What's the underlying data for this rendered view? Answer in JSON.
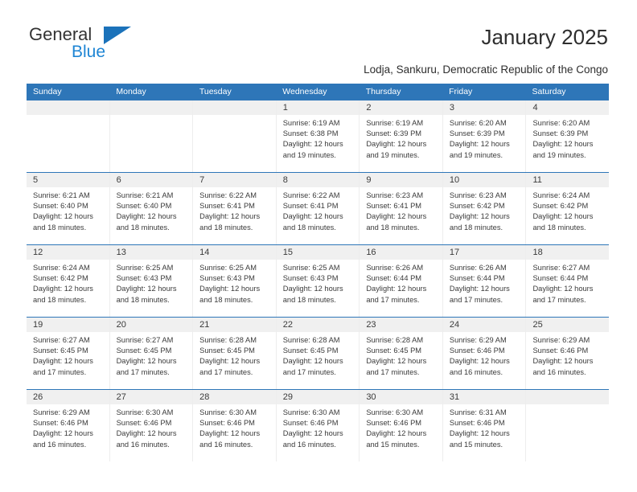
{
  "brand": {
    "name_primary": "General",
    "name_secondary": "Blue",
    "triangle_color": "#1B72BA",
    "secondary_color": "#1E85D4"
  },
  "header": {
    "title": "January 2025",
    "subtitle": "Lodja, Sankuru, Democratic Republic of the Congo",
    "accent_color": "#2E76B8"
  },
  "calendar": {
    "weekday_headers": [
      "Sunday",
      "Monday",
      "Tuesday",
      "Wednesday",
      "Thursday",
      "Friday",
      "Saturday"
    ],
    "weeks": [
      [
        {
          "day": "",
          "sunrise": "",
          "sunset": "",
          "daylight1": "",
          "daylight2": ""
        },
        {
          "day": "",
          "sunrise": "",
          "sunset": "",
          "daylight1": "",
          "daylight2": ""
        },
        {
          "day": "",
          "sunrise": "",
          "sunset": "",
          "daylight1": "",
          "daylight2": ""
        },
        {
          "day": "1",
          "sunrise": "Sunrise: 6:19 AM",
          "sunset": "Sunset: 6:38 PM",
          "daylight1": "Daylight: 12 hours",
          "daylight2": "and 19 minutes."
        },
        {
          "day": "2",
          "sunrise": "Sunrise: 6:19 AM",
          "sunset": "Sunset: 6:39 PM",
          "daylight1": "Daylight: 12 hours",
          "daylight2": "and 19 minutes."
        },
        {
          "day": "3",
          "sunrise": "Sunrise: 6:20 AM",
          "sunset": "Sunset: 6:39 PM",
          "daylight1": "Daylight: 12 hours",
          "daylight2": "and 19 minutes."
        },
        {
          "day": "4",
          "sunrise": "Sunrise: 6:20 AM",
          "sunset": "Sunset: 6:39 PM",
          "daylight1": "Daylight: 12 hours",
          "daylight2": "and 19 minutes."
        }
      ],
      [
        {
          "day": "5",
          "sunrise": "Sunrise: 6:21 AM",
          "sunset": "Sunset: 6:40 PM",
          "daylight1": "Daylight: 12 hours",
          "daylight2": "and 18 minutes."
        },
        {
          "day": "6",
          "sunrise": "Sunrise: 6:21 AM",
          "sunset": "Sunset: 6:40 PM",
          "daylight1": "Daylight: 12 hours",
          "daylight2": "and 18 minutes."
        },
        {
          "day": "7",
          "sunrise": "Sunrise: 6:22 AM",
          "sunset": "Sunset: 6:41 PM",
          "daylight1": "Daylight: 12 hours",
          "daylight2": "and 18 minutes."
        },
        {
          "day": "8",
          "sunrise": "Sunrise: 6:22 AM",
          "sunset": "Sunset: 6:41 PM",
          "daylight1": "Daylight: 12 hours",
          "daylight2": "and 18 minutes."
        },
        {
          "day": "9",
          "sunrise": "Sunrise: 6:23 AM",
          "sunset": "Sunset: 6:41 PM",
          "daylight1": "Daylight: 12 hours",
          "daylight2": "and 18 minutes."
        },
        {
          "day": "10",
          "sunrise": "Sunrise: 6:23 AM",
          "sunset": "Sunset: 6:42 PM",
          "daylight1": "Daylight: 12 hours",
          "daylight2": "and 18 minutes."
        },
        {
          "day": "11",
          "sunrise": "Sunrise: 6:24 AM",
          "sunset": "Sunset: 6:42 PM",
          "daylight1": "Daylight: 12 hours",
          "daylight2": "and 18 minutes."
        }
      ],
      [
        {
          "day": "12",
          "sunrise": "Sunrise: 6:24 AM",
          "sunset": "Sunset: 6:42 PM",
          "daylight1": "Daylight: 12 hours",
          "daylight2": "and 18 minutes."
        },
        {
          "day": "13",
          "sunrise": "Sunrise: 6:25 AM",
          "sunset": "Sunset: 6:43 PM",
          "daylight1": "Daylight: 12 hours",
          "daylight2": "and 18 minutes."
        },
        {
          "day": "14",
          "sunrise": "Sunrise: 6:25 AM",
          "sunset": "Sunset: 6:43 PM",
          "daylight1": "Daylight: 12 hours",
          "daylight2": "and 18 minutes."
        },
        {
          "day": "15",
          "sunrise": "Sunrise: 6:25 AM",
          "sunset": "Sunset: 6:43 PM",
          "daylight1": "Daylight: 12 hours",
          "daylight2": "and 18 minutes."
        },
        {
          "day": "16",
          "sunrise": "Sunrise: 6:26 AM",
          "sunset": "Sunset: 6:44 PM",
          "daylight1": "Daylight: 12 hours",
          "daylight2": "and 17 minutes."
        },
        {
          "day": "17",
          "sunrise": "Sunrise: 6:26 AM",
          "sunset": "Sunset: 6:44 PM",
          "daylight1": "Daylight: 12 hours",
          "daylight2": "and 17 minutes."
        },
        {
          "day": "18",
          "sunrise": "Sunrise: 6:27 AM",
          "sunset": "Sunset: 6:44 PM",
          "daylight1": "Daylight: 12 hours",
          "daylight2": "and 17 minutes."
        }
      ],
      [
        {
          "day": "19",
          "sunrise": "Sunrise: 6:27 AM",
          "sunset": "Sunset: 6:45 PM",
          "daylight1": "Daylight: 12 hours",
          "daylight2": "and 17 minutes."
        },
        {
          "day": "20",
          "sunrise": "Sunrise: 6:27 AM",
          "sunset": "Sunset: 6:45 PM",
          "daylight1": "Daylight: 12 hours",
          "daylight2": "and 17 minutes."
        },
        {
          "day": "21",
          "sunrise": "Sunrise: 6:28 AM",
          "sunset": "Sunset: 6:45 PM",
          "daylight1": "Daylight: 12 hours",
          "daylight2": "and 17 minutes."
        },
        {
          "day": "22",
          "sunrise": "Sunrise: 6:28 AM",
          "sunset": "Sunset: 6:45 PM",
          "daylight1": "Daylight: 12 hours",
          "daylight2": "and 17 minutes."
        },
        {
          "day": "23",
          "sunrise": "Sunrise: 6:28 AM",
          "sunset": "Sunset: 6:45 PM",
          "daylight1": "Daylight: 12 hours",
          "daylight2": "and 17 minutes."
        },
        {
          "day": "24",
          "sunrise": "Sunrise: 6:29 AM",
          "sunset": "Sunset: 6:46 PM",
          "daylight1": "Daylight: 12 hours",
          "daylight2": "and 16 minutes."
        },
        {
          "day": "25",
          "sunrise": "Sunrise: 6:29 AM",
          "sunset": "Sunset: 6:46 PM",
          "daylight1": "Daylight: 12 hours",
          "daylight2": "and 16 minutes."
        }
      ],
      [
        {
          "day": "26",
          "sunrise": "Sunrise: 6:29 AM",
          "sunset": "Sunset: 6:46 PM",
          "daylight1": "Daylight: 12 hours",
          "daylight2": "and 16 minutes."
        },
        {
          "day": "27",
          "sunrise": "Sunrise: 6:30 AM",
          "sunset": "Sunset: 6:46 PM",
          "daylight1": "Daylight: 12 hours",
          "daylight2": "and 16 minutes."
        },
        {
          "day": "28",
          "sunrise": "Sunrise: 6:30 AM",
          "sunset": "Sunset: 6:46 PM",
          "daylight1": "Daylight: 12 hours",
          "daylight2": "and 16 minutes."
        },
        {
          "day": "29",
          "sunrise": "Sunrise: 6:30 AM",
          "sunset": "Sunset: 6:46 PM",
          "daylight1": "Daylight: 12 hours",
          "daylight2": "and 16 minutes."
        },
        {
          "day": "30",
          "sunrise": "Sunrise: 6:30 AM",
          "sunset": "Sunset: 6:46 PM",
          "daylight1": "Daylight: 12 hours",
          "daylight2": "and 15 minutes."
        },
        {
          "day": "31",
          "sunrise": "Sunrise: 6:31 AM",
          "sunset": "Sunset: 6:46 PM",
          "daylight1": "Daylight: 12 hours",
          "daylight2": "and 15 minutes."
        },
        {
          "day": "",
          "sunrise": "",
          "sunset": "",
          "daylight1": "",
          "daylight2": ""
        }
      ]
    ]
  }
}
